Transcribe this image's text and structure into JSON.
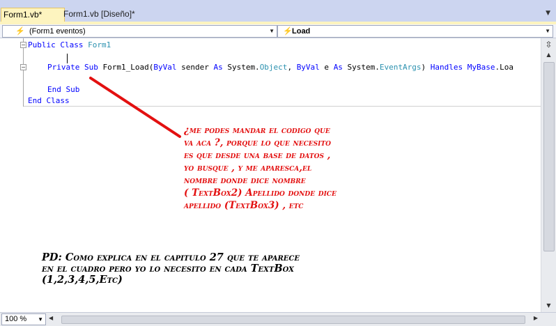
{
  "tabs": [
    {
      "label": "Form1.vb*",
      "active": true
    },
    {
      "label": "Form1.vb [Diseño]*",
      "active": false
    }
  ],
  "navbar": {
    "left_combo": "(Form1 eventos)",
    "right_combo": "Load"
  },
  "code": {
    "line1": {
      "kw": "Public Class",
      "name": "Form1"
    },
    "line2": {
      "kw1": "Private Sub",
      "rest1": " Form1_Load(",
      "kw2": "ByVal",
      "rest2": " sender ",
      "kw3": "As",
      "rest3": " System.",
      "t1": "Object",
      "rest4": ", ",
      "kw4": "ByVal",
      "rest5": " e ",
      "kw5": "As",
      "rest6": " System.",
      "t2": "EventArgs",
      "rest7": ") ",
      "kw6": "Handles",
      "rest8": " ",
      "kw7": "MyBase",
      "rest9": ".Loa"
    },
    "line3": "End Sub",
    "line4": "End Class"
  },
  "zoom": "100 %",
  "annotation_red": [
    "¿me podes mandar el codigo que",
    "va aca ?, porque lo que necesito",
    "es que desde una base de datos ,",
    "yo busque , y me aparesca,el",
    "nombre donde dice nombre",
    "( TextBox2) Apellido donde dice",
    "apellido (TextBox3) , etc"
  ],
  "annotation_black": [
    "PD: Como explica en el capitulo 27 que te aparece",
    "en el cuadro pero yo lo necesito en cada TextBox",
    "(1,2,3,4,5,Etc)"
  ],
  "colors": {
    "keyword": "#0000ff",
    "type": "#2b91af",
    "annotation_red": "#e31010",
    "arrow": "#e31010"
  }
}
